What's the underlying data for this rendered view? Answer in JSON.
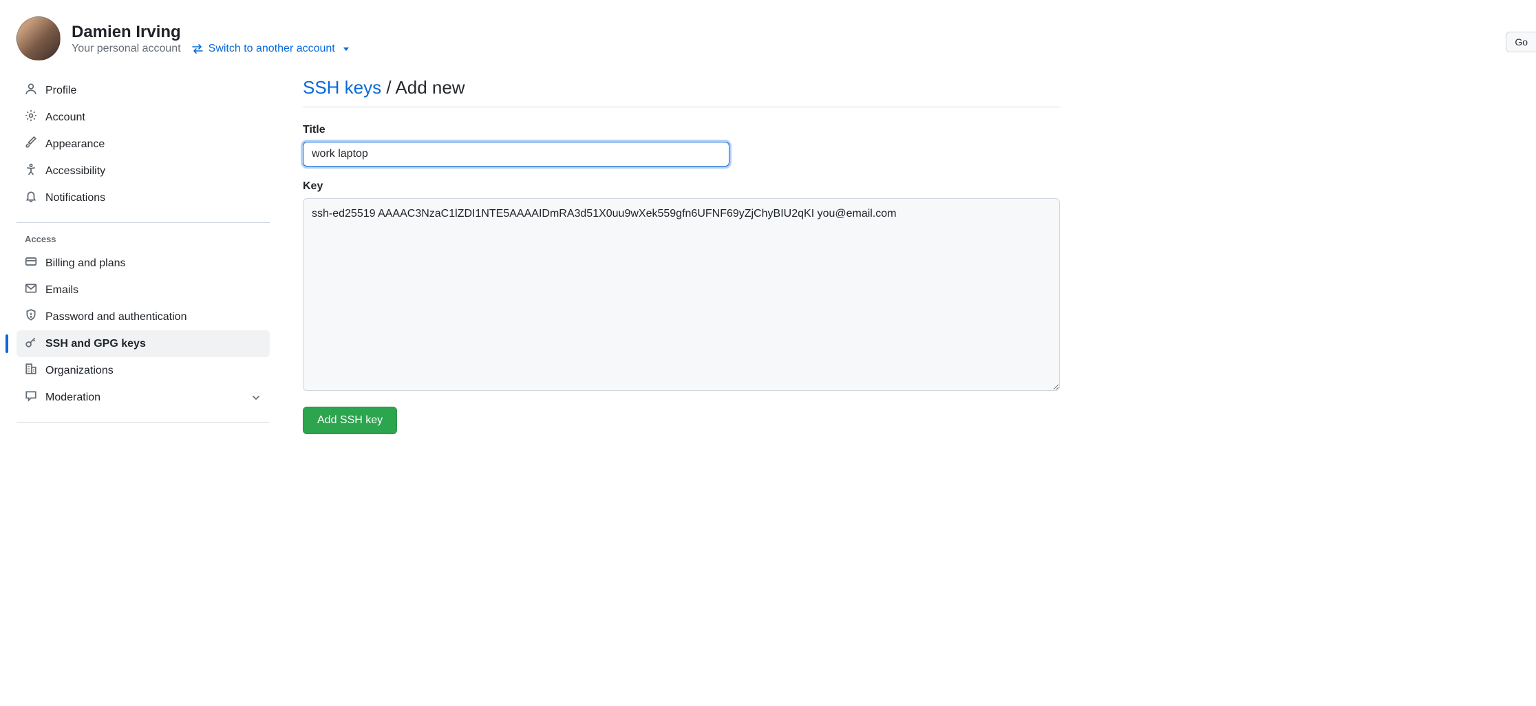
{
  "header": {
    "name": "Damien Irving",
    "subtitle": "Your personal account",
    "switch_label": "Switch to another account",
    "go_label": "Go"
  },
  "sidebar": {
    "group1": [
      {
        "label": "Profile",
        "icon": "person"
      },
      {
        "label": "Account",
        "icon": "gear"
      },
      {
        "label": "Appearance",
        "icon": "brush"
      },
      {
        "label": "Accessibility",
        "icon": "accessibility"
      },
      {
        "label": "Notifications",
        "icon": "bell"
      }
    ],
    "access_heading": "Access",
    "group2": [
      {
        "label": "Billing and plans",
        "icon": "credit-card"
      },
      {
        "label": "Emails",
        "icon": "mail"
      },
      {
        "label": "Password and authentication",
        "icon": "shield"
      },
      {
        "label": "SSH and GPG keys",
        "icon": "key",
        "selected": true
      },
      {
        "label": "Organizations",
        "icon": "organization"
      },
      {
        "label": "Moderation",
        "icon": "comment",
        "expandable": true
      }
    ]
  },
  "page": {
    "breadcrumb_link": "SSH keys",
    "breadcrumb_current": "Add new",
    "title_label": "Title",
    "title_value": "work laptop",
    "key_label": "Key",
    "key_value": "ssh-ed25519 AAAAC3NzaC1lZDI1NTE5AAAAIDmRA3d51X0uu9wXek559gfn6UFNF69yZjChyBIU2qKI you@email.com",
    "submit_label": "Add SSH key"
  }
}
